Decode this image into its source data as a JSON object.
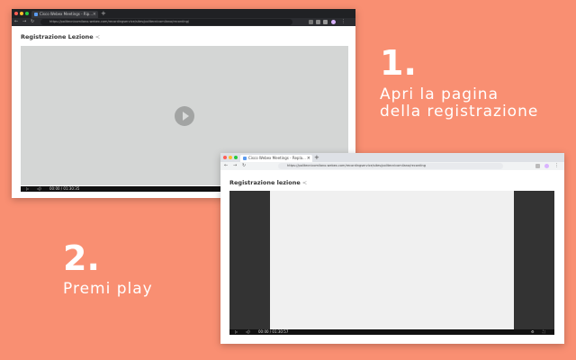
{
  "colors": {
    "background": "#f98f72",
    "video_gray": "#d4d6d5",
    "dark_bar": "#333333"
  },
  "window1": {
    "tab_title": "Cisco Webex Meetings - Rip...",
    "url": "https://politecnicomilano.webex.com/recordingservice/sites/politecnicomilano/recording/",
    "page_title": "Registrazione Lezione",
    "time": "00:00 / 01:30:35"
  },
  "window2": {
    "tab_title": "Cisco Webex Meetings - Repla...",
    "url": "https://politecnicomilano.webex.com/recordingservice/sites/politecnicomilano/recording",
    "page_title": "Registrazione lezione",
    "time": "00:00 / 01:30:57"
  },
  "step1": {
    "number": "1.",
    "line1": "Apri la pagina",
    "line2": "della registrazione"
  },
  "step2": {
    "number": "2.",
    "line1": "Premi play"
  },
  "icons": {
    "share": "share-icon",
    "play": "play-icon",
    "close": "close-icon",
    "new_tab": "plus-icon"
  }
}
